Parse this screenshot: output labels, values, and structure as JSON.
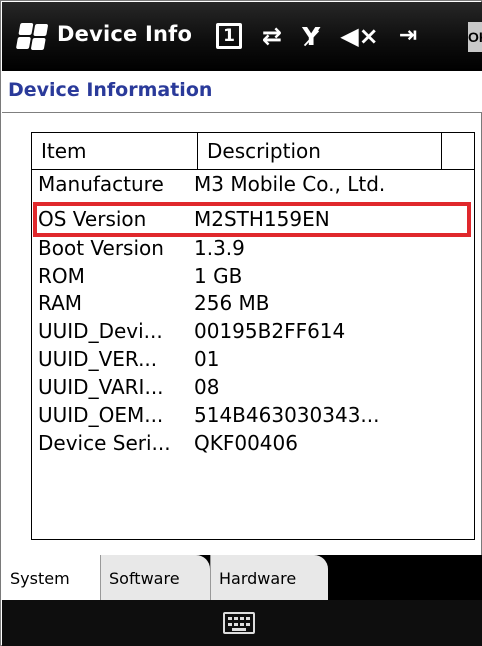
{
  "titlebar": {
    "app_title": "Device Info",
    "icons": [
      "windows-start-icon",
      "battery-icon",
      "sync-icon",
      "signal-off-icon",
      "speaker-mute-icon",
      "exit-icon"
    ],
    "battery_glyph": "1",
    "ok_label": "OK"
  },
  "header": {
    "title": "Device Information"
  },
  "table": {
    "columns": [
      "Item",
      "Description"
    ],
    "rows": [
      {
        "item": "Manufacture",
        "description": "M3 Mobile Co., Ltd."
      },
      {
        "item": "OS Version",
        "description": "M2STH159EN"
      },
      {
        "item": "Boot Version",
        "description": "1.3.9"
      },
      {
        "item": "ROM",
        "description": "1 GB"
      },
      {
        "item": "RAM",
        "description": "256 MB"
      },
      {
        "item": "UUID_Devi...",
        "description": "00195B2FF614"
      },
      {
        "item": "UUID_VER...",
        "description": "01"
      },
      {
        "item": "UUID_VARI...",
        "description": "08"
      },
      {
        "item": "UUID_OEM...",
        "description": "514B463030343..."
      },
      {
        "item": "Device Seri...",
        "description": "QKF00406"
      }
    ],
    "highlighted_row": "OS Version",
    "highlight_color": "#e0282c"
  },
  "tabs": [
    {
      "label": "System",
      "active": true
    },
    {
      "label": "Software",
      "active": false
    },
    {
      "label": "Hardware",
      "active": false
    }
  ],
  "colors": {
    "header_title": "#2a3a9a",
    "titlebar_bg": "#000000"
  }
}
